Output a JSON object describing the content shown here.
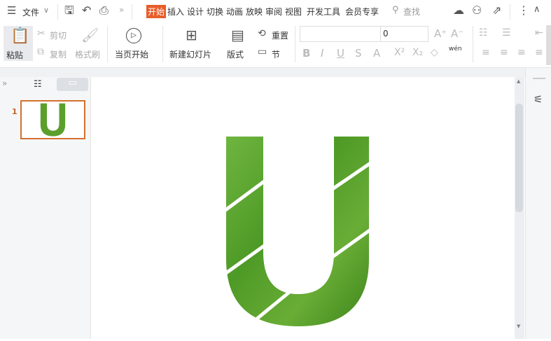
{
  "titlebar": {
    "file_menu": "文件",
    "tabs": [
      "开始",
      "插入",
      "设计",
      "切换",
      "动画",
      "放映",
      "审阅",
      "视图",
      "开发工具",
      "会员专享"
    ],
    "active_tab": "开始",
    "search": "查找"
  },
  "ribbon": {
    "paste": "粘贴",
    "cut": "剪切",
    "copy": "复制",
    "format_painter": "格式刷",
    "play_from_current": "当页开始",
    "new_slide": "新建幻灯片",
    "layout": "版式",
    "reset": "重置",
    "section": "节",
    "font_name": "",
    "font_size": "0",
    "phonetic": "wén"
  },
  "slides_panel": {
    "slide_number": "1",
    "thumb_letter": "U"
  },
  "slide": {
    "letter": "U",
    "accent": "#e85d2a",
    "fill": "#4f9a2a"
  }
}
